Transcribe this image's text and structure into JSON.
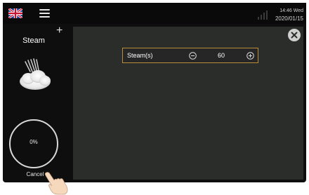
{
  "topbar": {
    "language_flag": "uk-flag-icon",
    "menu_icon": "hamburger-menu-icon",
    "signal_icon": "signal-strength-icon",
    "time": "14:46 Wed",
    "date": "2020/01/15"
  },
  "sidebar": {
    "add_icon": "plus-icon",
    "mode_title": "Steam",
    "mode_image": "steam-cloud-icon",
    "progress_value": 0,
    "progress_text": "0%",
    "cancel_label": "Cancel"
  },
  "panel": {
    "close_icon": "close-icon",
    "parameter": {
      "label": "Steam(s)",
      "value": "60",
      "decrement_icon": "minus-circle-icon",
      "increment_icon": "plus-circle-icon"
    }
  },
  "overlay": {
    "pointer_icon": "pointing-hand-icon"
  },
  "colors": {
    "background": "#0e0e0e",
    "panel": "#2b2d2b",
    "param_border": "#b98d3a",
    "text": "#ffffff"
  }
}
